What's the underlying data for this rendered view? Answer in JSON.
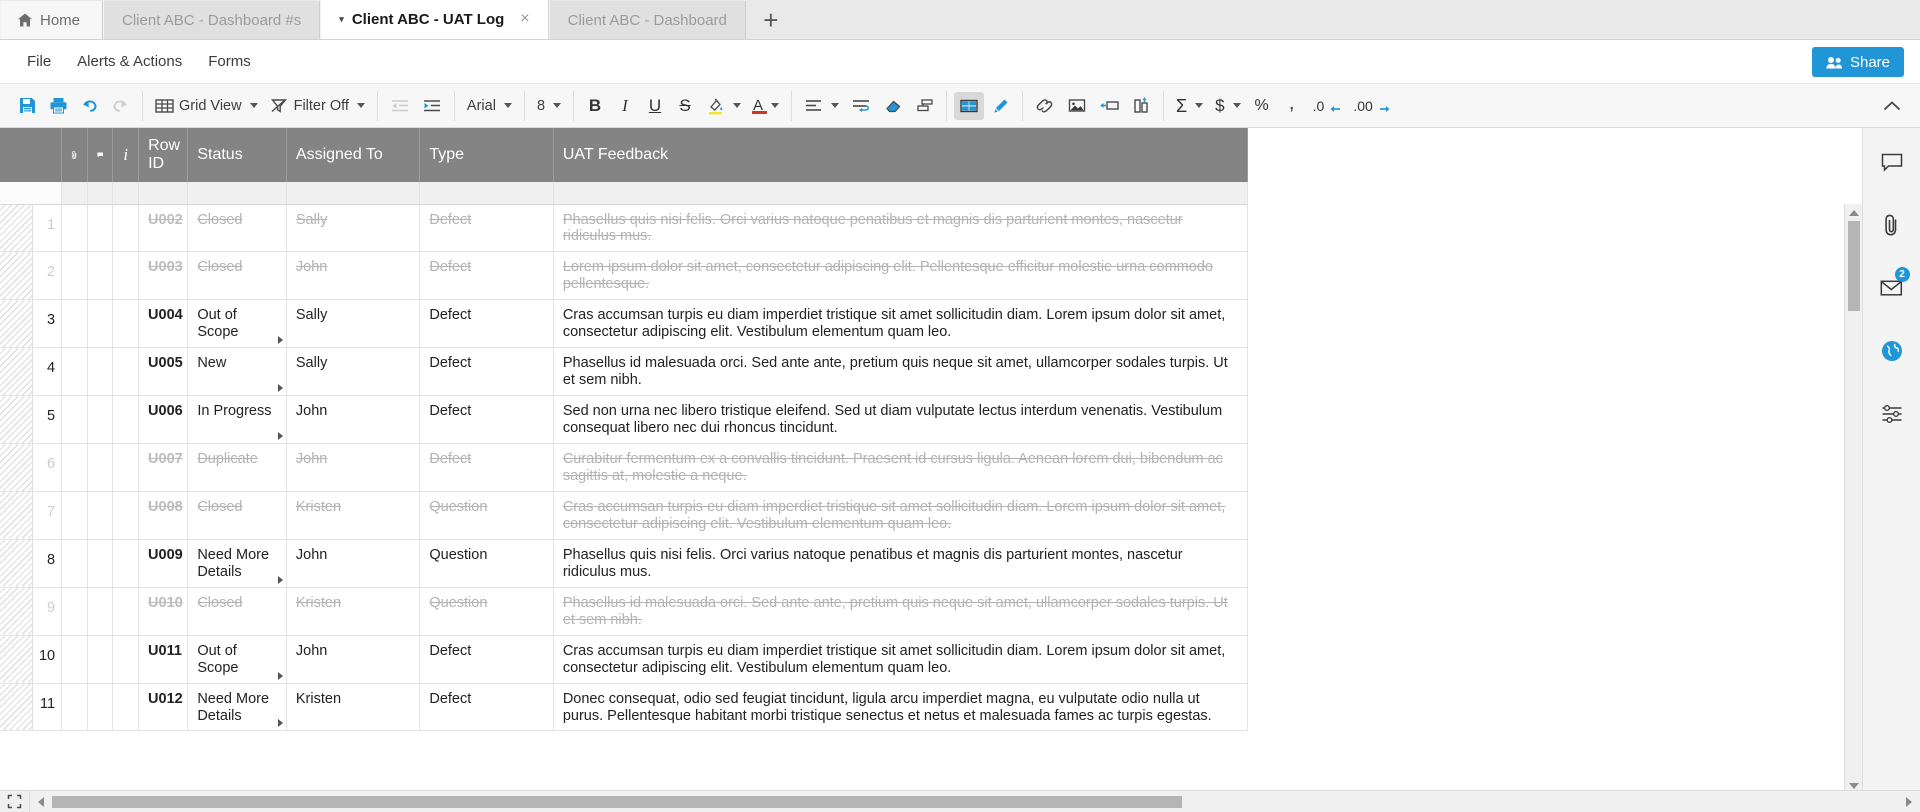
{
  "tabs": [
    {
      "label": "Home",
      "icon": "home-icon",
      "active": false,
      "type": "home"
    },
    {
      "label": "Client ABC - Dashboard #s",
      "active": false,
      "type": "sheet"
    },
    {
      "label": "Client ABC - UAT Log",
      "active": true,
      "type": "sheet",
      "close": "×",
      "caret": "▾"
    },
    {
      "label": "Client ABC - Dashboard",
      "active": false,
      "type": "sheet"
    }
  ],
  "tab_add_label": "+",
  "menu": {
    "items": [
      "File",
      "Alerts & Actions",
      "Forms"
    ],
    "share_label": "Share",
    "share_icon": "people-icon",
    "share_color": "#2196d6"
  },
  "toolbar": {
    "groups": [
      {
        "buttons": [
          {
            "name": "save-button",
            "icon": "save-icon",
            "label": ""
          },
          {
            "name": "print-button",
            "icon": "print-icon",
            "label": ""
          },
          {
            "name": "undo-button",
            "icon": "undo-icon",
            "label": ""
          },
          {
            "name": "redo-button",
            "icon": "redo-icon",
            "label": "",
            "disabled": true
          }
        ]
      },
      {
        "buttons": [
          {
            "name": "grid-view-button",
            "icon": "grid-icon",
            "label": "Grid View",
            "caret": true
          },
          {
            "name": "filter-button",
            "icon": "filter-icon",
            "label": "Filter Off",
            "caret": true
          }
        ]
      },
      {
        "buttons": [
          {
            "name": "outdent-button",
            "icon": "outdent-icon",
            "label": "",
            "disabled": true
          },
          {
            "name": "indent-button",
            "icon": "indent-icon",
            "label": ""
          }
        ]
      },
      {
        "buttons": [
          {
            "name": "font-family-select",
            "icon": "",
            "label": "Arial",
            "caret": true
          }
        ]
      },
      {
        "buttons": [
          {
            "name": "font-size-select",
            "icon": "",
            "label": "8",
            "caret": true
          }
        ]
      },
      {
        "buttons": [
          {
            "name": "bold-button",
            "icon": "bold-icon",
            "label": "B"
          },
          {
            "name": "italic-button",
            "icon": "italic-icon",
            "label": "I"
          },
          {
            "name": "underline-button",
            "icon": "underline-icon",
            "label": "U"
          },
          {
            "name": "strikethrough-button",
            "icon": "strikethrough-icon",
            "label": "S"
          },
          {
            "name": "fill-color-button",
            "icon": "fill-color-icon",
            "label": "",
            "caret": true
          },
          {
            "name": "text-color-button",
            "icon": "text-color-icon",
            "label": "A",
            "caret": true
          }
        ]
      },
      {
        "buttons": [
          {
            "name": "align-button",
            "icon": "align-left-icon",
            "label": "",
            "caret": true
          },
          {
            "name": "wrap-text-button",
            "icon": "wrap-text-icon",
            "label": ""
          },
          {
            "name": "clear-format-button",
            "icon": "eraser-icon",
            "label": ""
          },
          {
            "name": "format-painter-button",
            "icon": "format-painter-icon",
            "label": ""
          }
        ]
      },
      {
        "buttons": [
          {
            "name": "cell-borders-button",
            "icon": "borders-icon",
            "label": "",
            "selected": true
          },
          {
            "name": "highlight-button",
            "icon": "highlight-pen-icon",
            "label": ""
          }
        ]
      },
      {
        "buttons": [
          {
            "name": "insert-link-button",
            "icon": "link-icon",
            "label": ""
          },
          {
            "name": "insert-image-button",
            "icon": "image-icon",
            "label": ""
          },
          {
            "name": "insert-row-button",
            "icon": "insert-row-icon",
            "label": ""
          },
          {
            "name": "insert-column-button",
            "icon": "insert-column-icon",
            "label": ""
          }
        ]
      },
      {
        "buttons": [
          {
            "name": "sum-button",
            "icon": "sigma-icon",
            "label": "",
            "caret": true
          },
          {
            "name": "currency-button",
            "icon": "currency-icon",
            "label": "",
            "caret": true
          },
          {
            "name": "percent-button",
            "icon": "percent-icon",
            "label": "%"
          },
          {
            "name": "comma-button",
            "icon": "comma-icon",
            "label": ","
          },
          {
            "name": "decrease-decimal-button",
            "icon": "decrease-decimal-icon",
            "label": ".0"
          },
          {
            "name": "increase-decimal-button",
            "icon": "increase-decimal-icon",
            "label": ".00"
          }
        ]
      }
    ],
    "collapse_icon": "chevron-up-icon"
  },
  "grid": {
    "columns": [
      {
        "key": "gutter",
        "label": "",
        "name": "column-header-gutter"
      },
      {
        "key": "attach",
        "label": "",
        "name": "column-header-attachment",
        "icon": "paperclip-icon"
      },
      {
        "key": "comment",
        "label": "",
        "name": "column-header-comment",
        "icon": "comment-icon"
      },
      {
        "key": "info",
        "label": "",
        "name": "column-header-info",
        "icon": "info-icon"
      },
      {
        "key": "rowid",
        "label": "Row ID",
        "name": "column-header-row-id"
      },
      {
        "key": "status",
        "label": "Status",
        "name": "column-header-status"
      },
      {
        "key": "assigned",
        "label": "Assigned To",
        "name": "column-header-assigned-to"
      },
      {
        "key": "type",
        "label": "Type",
        "name": "column-header-type"
      },
      {
        "key": "feedback",
        "label": "UAT Feedback",
        "name": "column-header-uat-feedback"
      }
    ],
    "rows": [
      {
        "num": "1",
        "rowid": "U002",
        "status": "Closed",
        "assigned": "Sally",
        "type": "Defect",
        "feedback": "Phasellus quis nisi felis. Orci varius natoque penatibus et magnis dis parturient montes, nascetur ridiculus mus.",
        "struck": true
      },
      {
        "num": "2",
        "rowid": "U003",
        "status": "Closed",
        "assigned": "John",
        "type": "Defect",
        "feedback": "Lorem ipsum dolor sit amet, consectetur adipiscing elit. Pellentesque efficitur molestie urna commodo pellentesque.",
        "struck": true
      },
      {
        "num": "3",
        "rowid": "U004",
        "status": "Out of Scope",
        "assigned": "Sally",
        "type": "Defect",
        "feedback": "Cras accumsan turpis eu diam imperdiet tristique sit amet sollicitudin diam. Lorem ipsum dolor sit amet, consectetur adipiscing elit. Vestibulum elementum quam leo.",
        "struck": false
      },
      {
        "num": "4",
        "rowid": "U005",
        "status": "New",
        "assigned": "Sally",
        "type": "Defect",
        "feedback": "Phasellus id malesuada orci. Sed ante ante, pretium quis neque sit amet, ullamcorper sodales turpis. Ut et sem nibh.",
        "struck": false
      },
      {
        "num": "5",
        "rowid": "U006",
        "status": "In Progress",
        "assigned": "John",
        "type": "Defect",
        "feedback": "Sed non urna nec libero tristique eleifend. Sed ut diam vulputate lectus interdum venenatis. Vestibulum consequat libero nec dui rhoncus tincidunt.",
        "struck": false
      },
      {
        "num": "6",
        "rowid": "U007",
        "status": "Duplicate",
        "assigned": "John",
        "type": "Defect",
        "feedback": "Curabitur fermentum ex a convallis tincidunt. Praesent id cursus ligula. Aenean lorem dui, bibendum ac sagittis at, molestie a neque.",
        "struck": true
      },
      {
        "num": "7",
        "rowid": "U008",
        "status": "Closed",
        "assigned": "Kristen",
        "type": "Question",
        "feedback": "Cras accumsan turpis eu diam imperdiet tristique sit amet sollicitudin diam. Lorem ipsum dolor sit amet, consectetur adipiscing elit. Vestibulum elementum quam leo.",
        "struck": true
      },
      {
        "num": "8",
        "rowid": "U009",
        "status": "Need More Details",
        "assigned": "John",
        "type": "Question",
        "feedback": "Phasellus quis nisi felis. Orci varius natoque penatibus et magnis dis parturient montes, nascetur ridiculus mus.",
        "struck": false
      },
      {
        "num": "9",
        "rowid": "U010",
        "status": "Closed",
        "assigned": "Kristen",
        "type": "Question",
        "feedback": "Phasellus id malesuada orci. Sed ante ante, pretium quis neque sit amet, ullamcorper sodales turpis. Ut et sem nibh.",
        "struck": true
      },
      {
        "num": "10",
        "rowid": "U011",
        "status": "Out of Scope",
        "assigned": "John",
        "type": "Defect",
        "feedback": "Cras accumsan turpis eu diam imperdiet tristique sit amet sollicitudin diam. Lorem ipsum dolor sit amet, consectetur adipiscing elit. Vestibulum elementum quam leo.",
        "struck": false
      },
      {
        "num": "11",
        "rowid": "U012",
        "status": "Need More Details",
        "assigned": "Kristen",
        "type": "Defect",
        "feedback": "Donec consequat, odio sed feugiat tincidunt, ligula arcu imperdiet magna, eu vulputate odio nulla ut purus. Pellentesque habitant morbi tristique senectus et netus et malesuada fames ac turpis egestas.",
        "struck": false
      }
    ],
    "header_bg": "#848484"
  },
  "right_rail": [
    {
      "name": "conversations-button",
      "icon": "comment-icon",
      "badge": ""
    },
    {
      "name": "attachments-button",
      "icon": "paperclip-icon",
      "badge": ""
    },
    {
      "name": "updates-button",
      "icon": "envelope-icon",
      "badge": "2"
    },
    {
      "name": "publish-button",
      "icon": "globe-icon",
      "badge": ""
    },
    {
      "name": "activity-log-button",
      "icon": "activity-icon",
      "badge": ""
    }
  ],
  "scrollbars": {
    "expand_icon": "expand-icon",
    "v_up_icon": "arrow-up-icon",
    "v_down_icon": "arrow-down-icon",
    "h_left_icon": "arrow-left-icon",
    "h_right_icon": "arrow-right-icon"
  }
}
